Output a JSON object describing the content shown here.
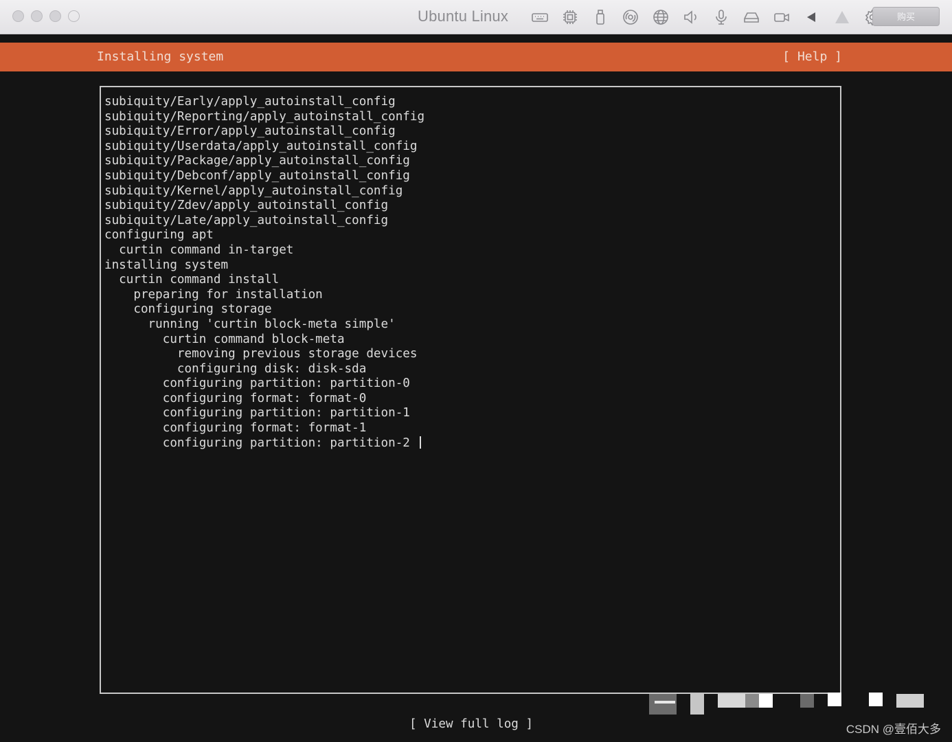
{
  "window": {
    "title": "Ubuntu Linux",
    "buy_label": "购买",
    "toolbar_icons": [
      "keyboard-icon",
      "cpu-icon",
      "usb-icon",
      "disc-icon",
      "network-icon",
      "speaker-icon",
      "microphone-icon",
      "hard-drive-icon",
      "camera-icon",
      "back-arrow-icon",
      "warning-icon",
      "gear-icon"
    ]
  },
  "installer": {
    "header_title": "Installing system",
    "help_label": "[ Help ]",
    "accent_color": "#d25d33",
    "log_lines": [
      "subiquity/Early/apply_autoinstall_config",
      "subiquity/Reporting/apply_autoinstall_config",
      "subiquity/Error/apply_autoinstall_config",
      "subiquity/Userdata/apply_autoinstall_config",
      "subiquity/Package/apply_autoinstall_config",
      "subiquity/Debconf/apply_autoinstall_config",
      "subiquity/Kernel/apply_autoinstall_config",
      "subiquity/Zdev/apply_autoinstall_config",
      "subiquity/Late/apply_autoinstall_config",
      "configuring apt",
      "  curtin command in-target",
      "installing system",
      "  curtin command install",
      "    preparing for installation",
      "    configuring storage",
      "      running 'curtin block-meta simple'",
      "        curtin command block-meta",
      "          removing previous storage devices",
      "          configuring disk: disk-sda",
      "        configuring partition: partition-0",
      "        configuring format: format-0",
      "        configuring partition: partition-1",
      "        configuring format: format-1",
      "        configuring partition: partition-2"
    ],
    "view_log_label": "[ View full log ]"
  },
  "watermark": "CSDN @壹佰大多"
}
